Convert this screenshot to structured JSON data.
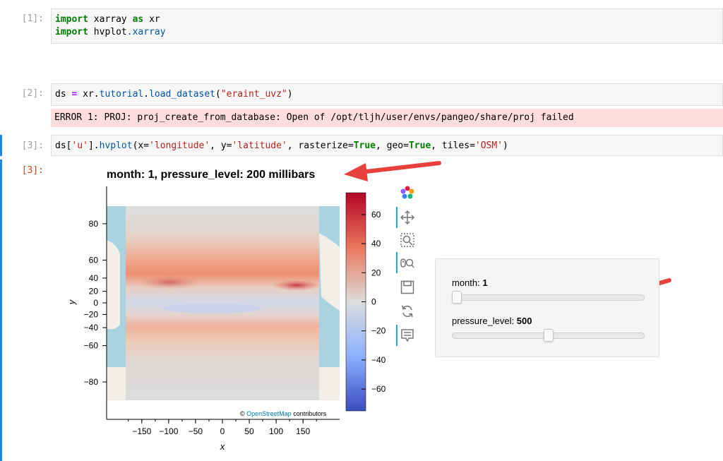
{
  "cells": [
    {
      "prompt": "[1]:"
    },
    {
      "prompt": "[2]:"
    },
    {
      "prompt": "[3]:"
    },
    {
      "output_prompt": "[3]:"
    }
  ],
  "cell1": {
    "line1_kw1": "import",
    "line1_mod": "xarray",
    "line1_kw2": "as",
    "line1_alias": "xr",
    "line2_kw": "import",
    "line2_mod": "hvplot",
    "line2_sub": ".xarray"
  },
  "cell2": {
    "code_a": "ds ",
    "eq": "=",
    "code_b": " xr.",
    "attr": "tutorial",
    "code_c": ".",
    "attr2": "load_dataset",
    "code_d": "(",
    "str": "\"eraint_uvz\"",
    "code_e": ")"
  },
  "error": {
    "text": "ERROR 1: PROJ: proj_create_from_database: Open of /opt/tljh/user/envs/pangeo/share/proj failed"
  },
  "cell3": {
    "p1": "ds[",
    "s1": "'u'",
    "p2": "].",
    "attr": "hvplot",
    "p3": "(x=",
    "s2": "'longitude'",
    "p4": ", y=",
    "s3": "'latitude'",
    "p5": ", rasterize=",
    "b1": "True",
    "p6": ", geo=",
    "b2": "True",
    "p7": ", tiles=",
    "s4": "'OSM'",
    "p8": ")"
  },
  "plot": {
    "title": "month: 1, pressure_level: 200 millibars",
    "xlabel": "x",
    "ylabel": "y",
    "xticks": [
      "−150",
      "−100",
      "−50",
      "0",
      "50",
      "100",
      "150"
    ],
    "yticks": [
      "80",
      "60",
      "40",
      "20",
      "0",
      "−20",
      "−40",
      "−60",
      "−80"
    ],
    "colorbar_ticks": [
      "60",
      "40",
      "20",
      "0",
      "−20",
      "−40",
      "−60"
    ],
    "attribution_prefix": "©",
    "attribution_link": "OpenStreetMap",
    "attribution_suffix": "contributors"
  },
  "chart_data": {
    "type": "heatmap",
    "title": "month: 1, pressure_level: 200 millibars",
    "xlabel": "x",
    "ylabel": "y",
    "x_ticks": [
      -150,
      -100,
      -50,
      0,
      50,
      100,
      150
    ],
    "y_ticks": [
      80,
      60,
      40,
      20,
      0,
      -20,
      -40,
      -60,
      -80
    ],
    "colorbar_ticks": [
      60,
      40,
      20,
      0,
      -20,
      -40,
      -60
    ],
    "colorbar_range": [
      -75,
      75
    ],
    "colormap": [
      "#3b4cc0",
      "#dddddd",
      "#b40426"
    ]
  },
  "widgets": {
    "month": {
      "label": "month:",
      "value": "1",
      "fraction": 0.0
    },
    "pressure_level": {
      "label": "pressure_level:",
      "value": "500",
      "fraction": 0.5
    }
  },
  "colors": {
    "arrow": "#e8413d",
    "accent": "#26aae1",
    "error_bg": "#ffdddd"
  },
  "toolbar": [
    "bokeh-logo-icon",
    "pan-icon",
    "box-zoom-icon",
    "wheel-zoom-icon",
    "save-icon",
    "reset-icon",
    "hover-icon"
  ]
}
